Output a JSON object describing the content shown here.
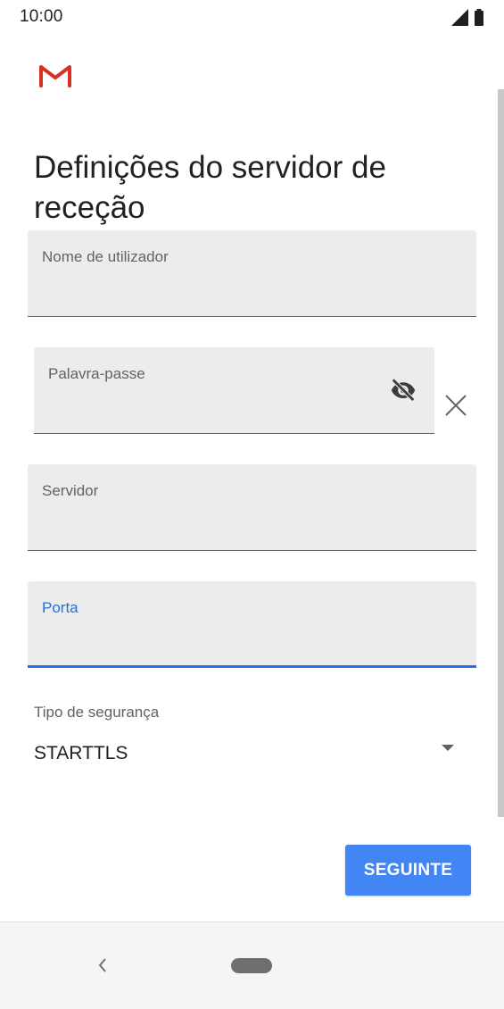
{
  "status_bar": {
    "time": "10:00",
    "icons": [
      "signal-icon",
      "battery-icon"
    ]
  },
  "app": {
    "logo": "gmail-logo"
  },
  "page": {
    "title": "Definições do servidor de receção"
  },
  "fields": {
    "username": {
      "label": "Nome de utilizador",
      "value": ""
    },
    "password": {
      "label": "Palavra-passe",
      "value": "",
      "toggle_icon": "eye-off-icon",
      "clear_icon": "close-icon"
    },
    "server": {
      "label": "Servidor",
      "value": ""
    },
    "port": {
      "label": "Porta",
      "value": "",
      "focused": true
    }
  },
  "security": {
    "label": "Tipo de segurança",
    "selected": "STARTTLS"
  },
  "actions": {
    "next_label": "SEGUINTE"
  },
  "nav_bar": {
    "icons": [
      "back-icon",
      "home-icon"
    ]
  },
  "colors": {
    "accent": "#1a73e8",
    "button": "#4285f4",
    "field_bg": "#ececec",
    "gmail_red": "#d93025"
  }
}
